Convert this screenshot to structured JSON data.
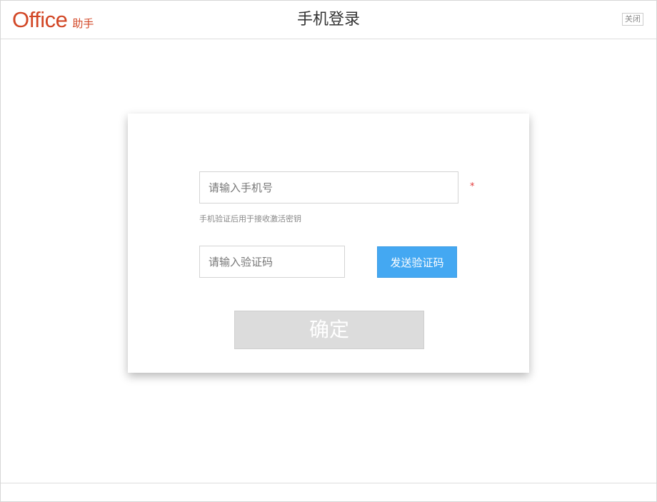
{
  "header": {
    "logo_main": "Office",
    "logo_sub": "助手",
    "title": "手机登录",
    "close_label": "关闭"
  },
  "form": {
    "phone_placeholder": "请输入手机号",
    "phone_value": "",
    "required_mark": "*",
    "hint": "手机验证后用于接收激活密钥",
    "code_placeholder": "请输入验证码",
    "code_value": "",
    "send_code_label": "发送验证码",
    "confirm_label": "确定"
  },
  "colors": {
    "brand": "#d24726",
    "send_button": "#44a8f2",
    "confirm_button_disabled": "#dcdcdc",
    "required_mark": "#e2393a"
  }
}
